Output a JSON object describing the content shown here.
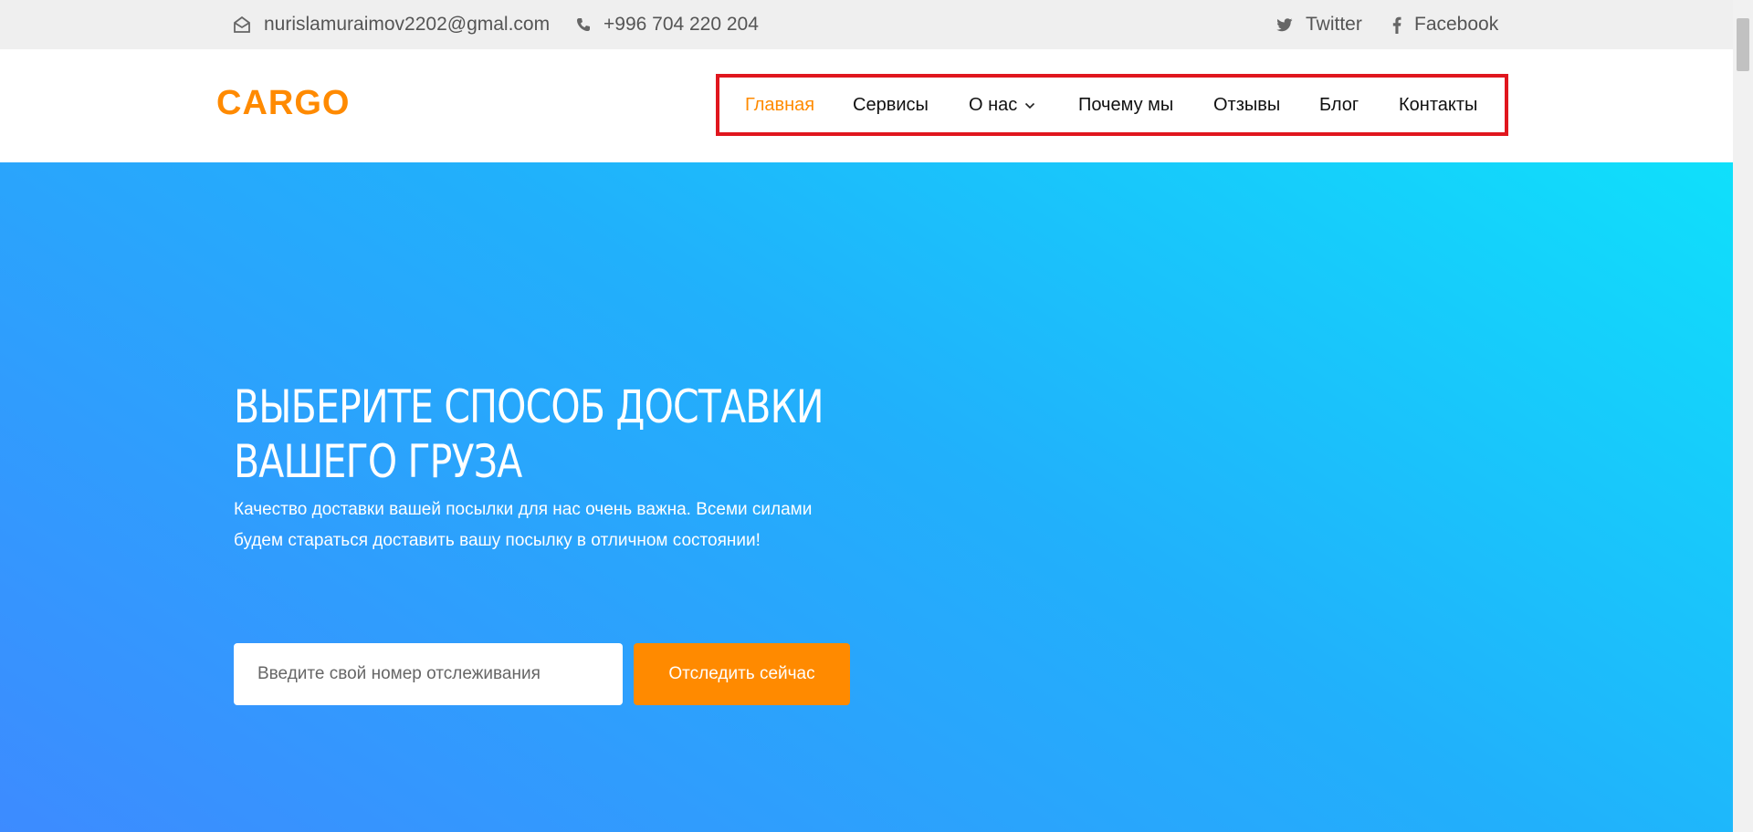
{
  "topbar": {
    "email": "nurislamuraimov2202@gmal.com",
    "phone": "+996 704 220 204",
    "twitter": "Twitter",
    "facebook": "Facebook"
  },
  "header": {
    "logo": "CARGO",
    "nav": [
      {
        "label": "Главная",
        "active": true
      },
      {
        "label": "Сервисы"
      },
      {
        "label": "О нас",
        "has_dropdown": true
      },
      {
        "label": "Почему мы"
      },
      {
        "label": "Отзывы"
      },
      {
        "label": "Блог"
      },
      {
        "label": "Контакты"
      }
    ]
  },
  "hero": {
    "title_line1": "ВЫБЕРИТЕ СПОСОБ ДОСТАВКИ",
    "title_line2": "ВАШЕГО ГРУЗА",
    "subtitle": "Качество доставки вашей посылки для нас очень важна. Всеми силами будем стараться доставить вашу посылку в отличном состоянии!",
    "tracking_placeholder": "Введите свой номер отслеживания",
    "tracking_value": "",
    "track_button": "Отследить сейчас"
  },
  "colors": {
    "accent": "#ff8a00",
    "highlight_box": "#e0161e",
    "hero_gradient_start": "#3d8bff",
    "hero_gradient_end": "#0fe0fb",
    "topbar_bg": "#efefef"
  },
  "icons": [
    "envelope-icon",
    "phone-icon",
    "twitter-icon",
    "facebook-icon",
    "chevron-down-icon"
  ]
}
